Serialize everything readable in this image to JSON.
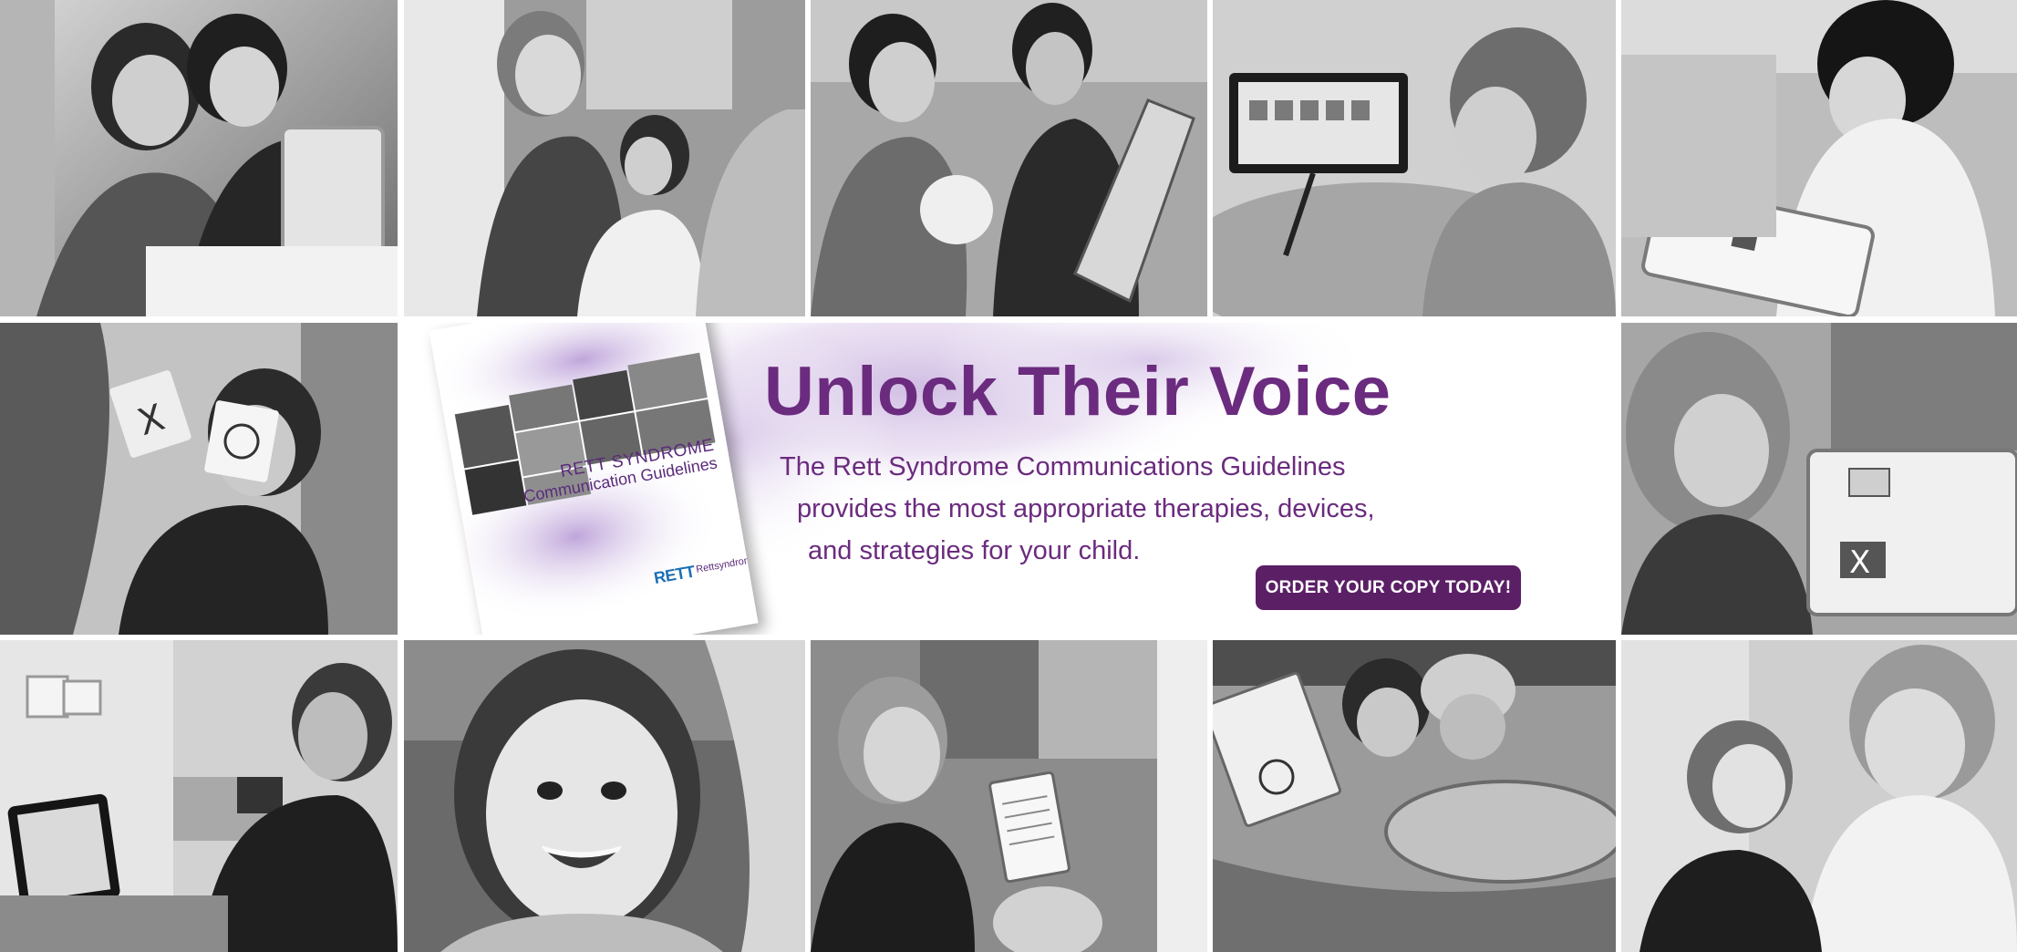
{
  "banner": {
    "headline": "Unlock Their Voice",
    "subtext_lines": [
      "The Rett Syndrome Communications Guidelines",
      "provides the most appropriate therapies, devices,",
      "and strategies for your child."
    ],
    "cta_label": "ORDER YOUR COPY TODAY!"
  },
  "booklet": {
    "title_line1": "RETT SYNDROME",
    "title_line2": "Communication Guidelines",
    "logo_text": "RETT",
    "org_text": "Rettsyndrome.org"
  },
  "photos": [
    {
      "icon": "photo-icon"
    },
    {
      "icon": "photo-icon"
    },
    {
      "icon": "photo-icon"
    },
    {
      "icon": "photo-icon"
    },
    {
      "icon": "photo-icon"
    },
    {
      "icon": "photo-icon"
    },
    {
      "icon": "photo-icon"
    },
    {
      "icon": "photo-icon"
    },
    {
      "icon": "photo-icon"
    },
    {
      "icon": "photo-icon"
    },
    {
      "icon": "photo-icon"
    },
    {
      "icon": "photo-icon"
    }
  ],
  "colors": {
    "brand_purple": "#6b2b7e",
    "button_purple": "#5b1f66",
    "wash_lavender": "#c9b3df",
    "photo_gray": "#8a8a8a"
  }
}
